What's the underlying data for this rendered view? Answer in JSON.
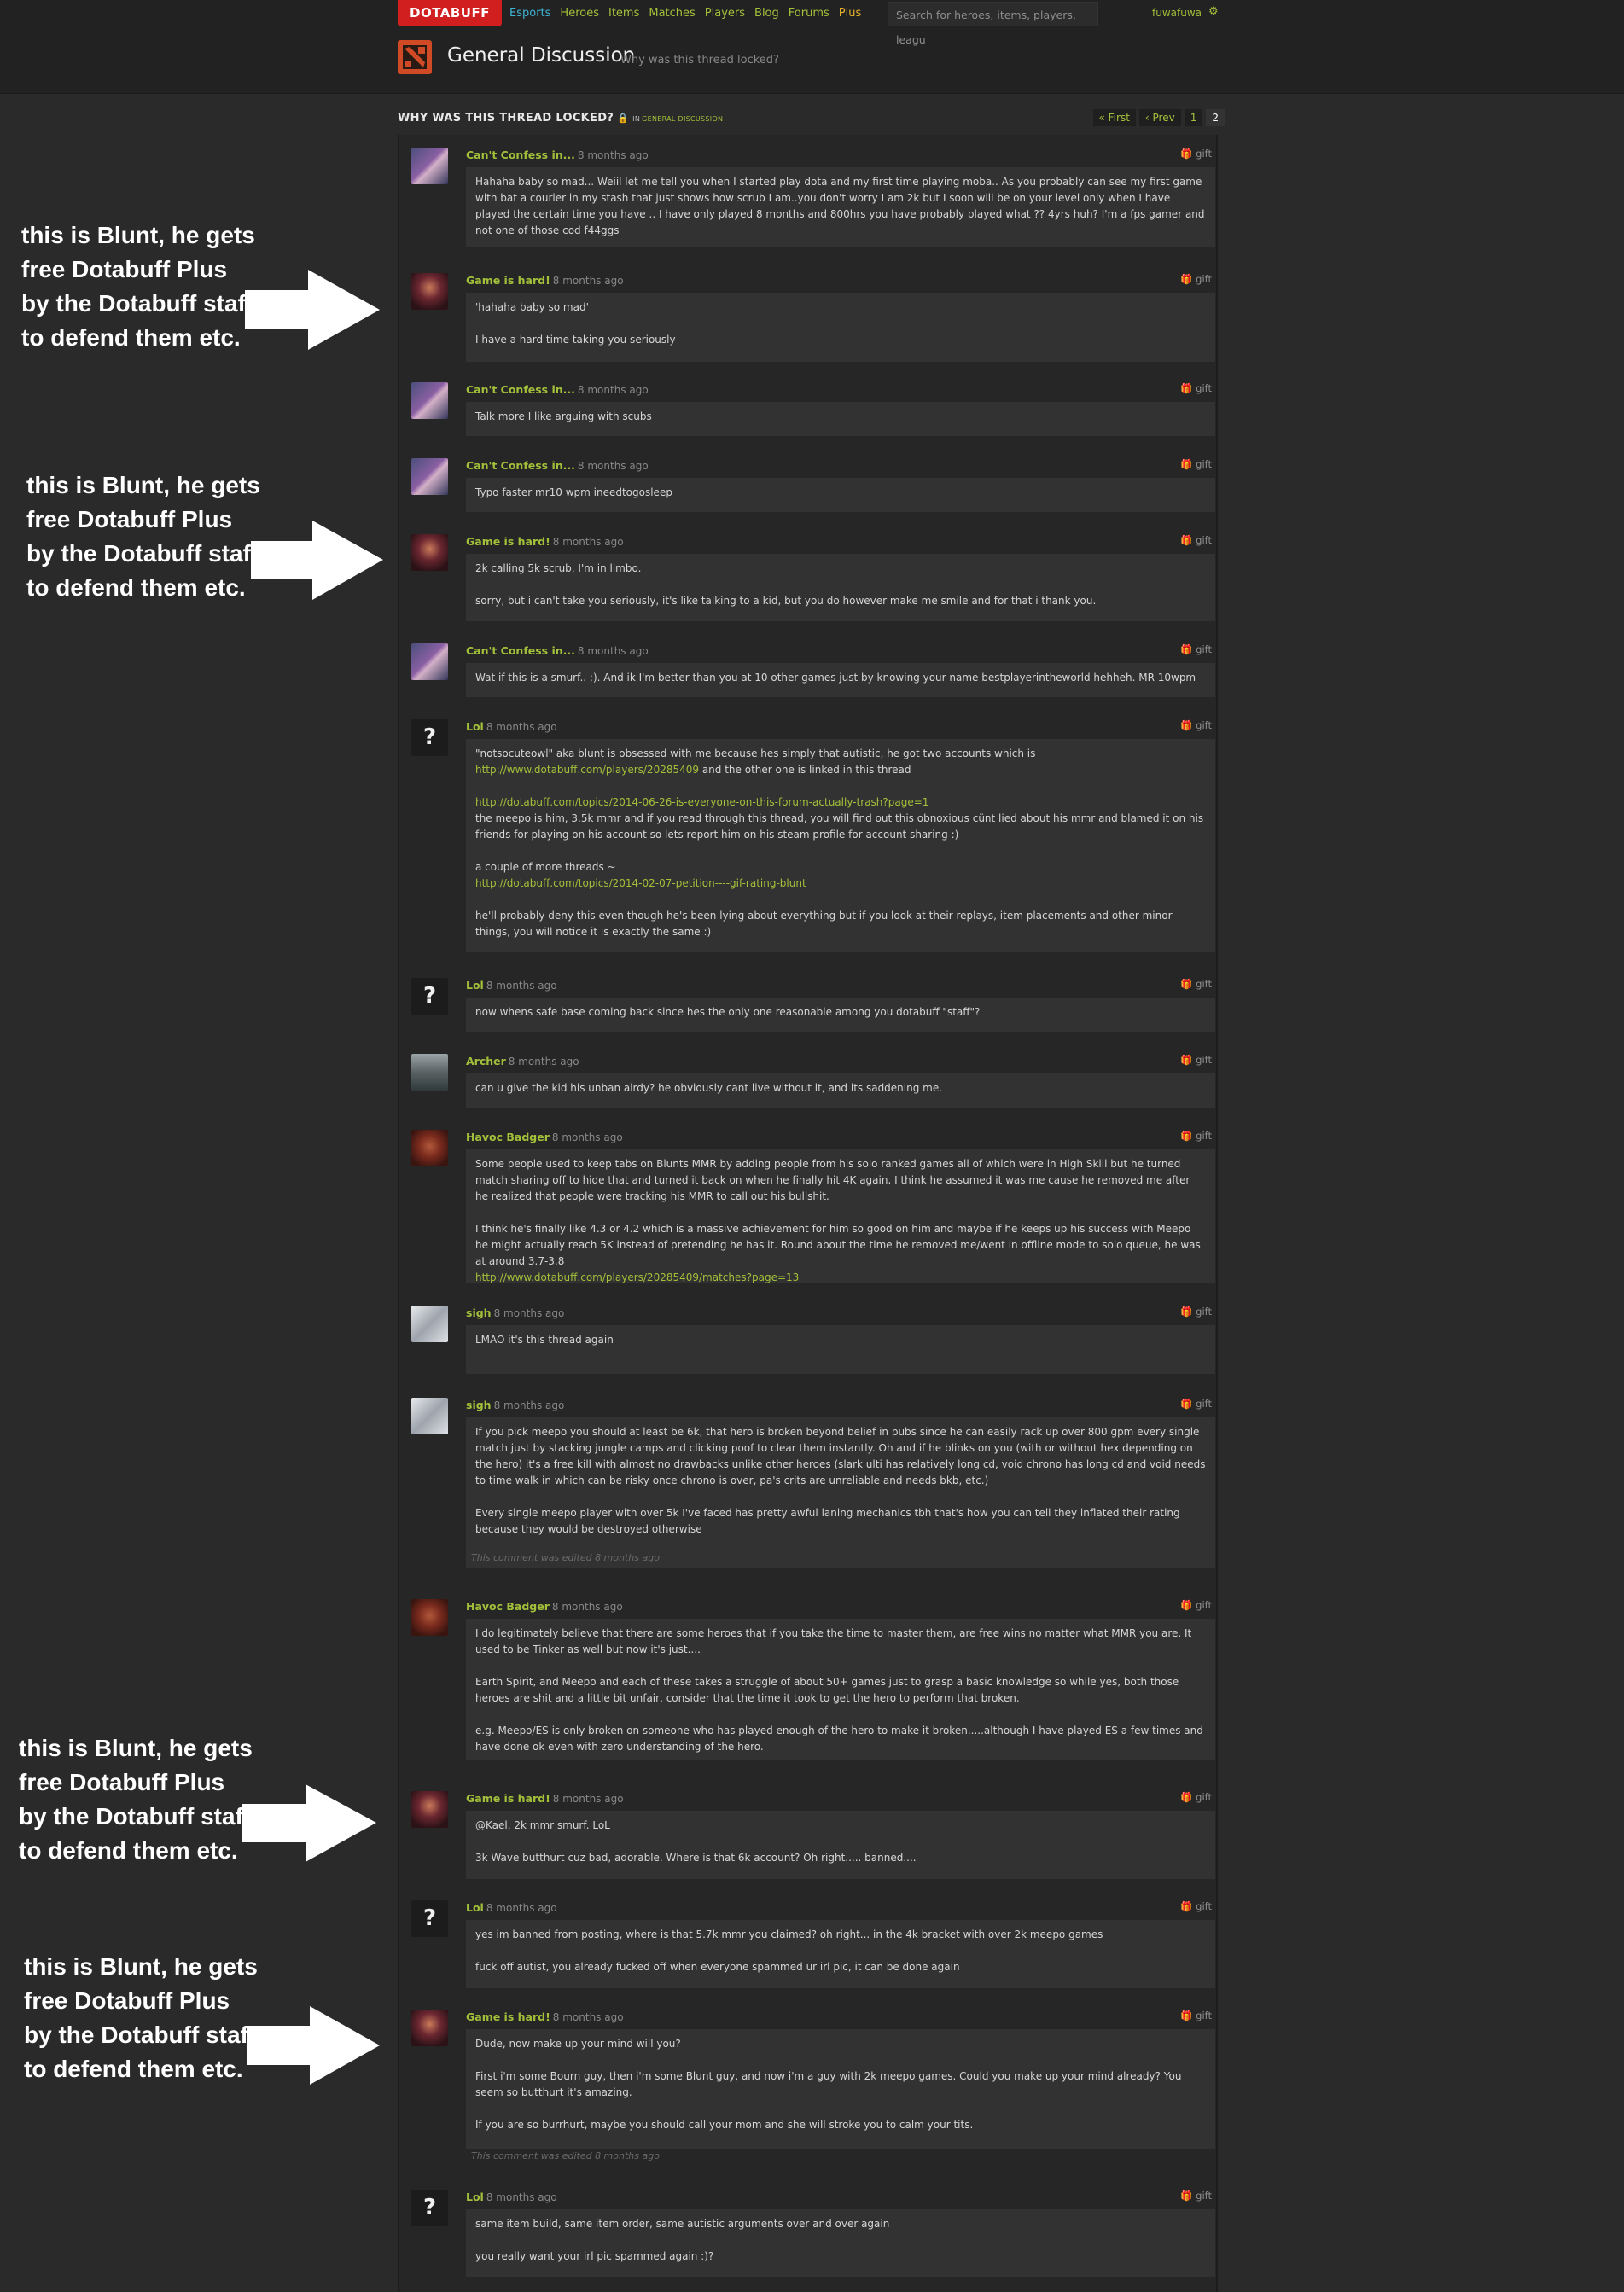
{
  "header": {
    "logo": "DOTABUFF",
    "nav": [
      "Esports",
      "Heroes",
      "Items",
      "Matches",
      "Players",
      "Blog",
      "Forums",
      "Plus"
    ],
    "search_placeholder": "Search for heroes, items, players, leagu",
    "username": "fuwafuwa"
  },
  "section": {
    "title": "General Discussion",
    "subtitle": "Why was this thread locked?"
  },
  "thread": {
    "title": "WHY WAS THIS THREAD LOCKED?",
    "in_label": "IN",
    "category": "GENERAL DISCUSSION",
    "pager": [
      "« First",
      "‹ Prev",
      "1",
      "2"
    ]
  },
  "gift_label": "gift",
  "edited_note": "This comment was edited 8 months ago",
  "annotation_text": "this is Blunt, he gets free Dotabuff Plus by the Dotabuff staff to defend them etc.",
  "posts": [
    {
      "author": "Can't Confess in...",
      "time": "8 months ago",
      "p": [
        "Hahaha baby so mad... Weiil let me tell you when I started play dota and my first time playing moba.. As you probably can see my first game with bat a courier in my stash that just shows how scrub I am..you don't worry I am 2k but I soon will be on your level only when I have played the certain time you have .. I have only played 8 months and 800hrs you have probably played what ?? 4yrs huh? I'm a fps gamer and not one of those cod f44ggs"
      ]
    },
    {
      "author": "Game is hard!",
      "time": "8 months ago",
      "p": [
        "'hahaha baby so mad'",
        "I have a hard time taking you seriously"
      ]
    },
    {
      "author": "Can't Confess in...",
      "time": "8 months ago",
      "p": [
        "Talk more I like arguing with scubs"
      ]
    },
    {
      "author": "Can't Confess in...",
      "time": "8 months ago",
      "p": [
        "Typo faster mr10 wpm ineedtogosleep"
      ]
    },
    {
      "author": "Game is hard!",
      "time": "8 months ago",
      "p": [
        "2k calling 5k scrub, I'm in limbo.",
        "sorry, but i can't take you seriously, it's like talking to a kid, but you do however make me smile and for that i thank you."
      ]
    },
    {
      "author": "Can't Confess in...",
      "time": "8 months ago",
      "p": [
        "Wat if this is a smurf.. ;). And ik I'm better than you at 10 other games just by knowing your name bestplayerintheworld hehheh. MR 10wpm"
      ]
    },
    {
      "author": "Lol",
      "time": "8 months ago",
      "p1a": "\"notsocuteowl\" aka blunt is obsessed with me because hes simply that autistic, he got two accounts which is ",
      "p1link": "http://www.dotabuff.com/players/20285409",
      "p1b": " and the other one is linked in this thread",
      "p2link": "http://dotabuff.com/topics/2014-06-26-is-everyone-on-this-forum-actually-trash?page=1",
      "p2text": "the meepo is him, 3.5k mmr and if you read through this thread, you will find out this obnoxious cünt lied about his mmr and blamed it on his friends for playing on his account so lets report him on his steam profile for account sharing :)",
      "p3text": "a couple of more threads ~",
      "p3link": "http://dotabuff.com/topics/2014-02-07-petition----gif-rating-blunt",
      "p4text": "he'll probably deny this even though he's been lying about everything but if you look at their replays, item placements and other minor things, you will notice it is exactly the same :)"
    },
    {
      "author": "Lol",
      "time": "8 months ago",
      "p": [
        "now whens safe base coming back since hes the only one reasonable among you dotabuff \"staff\"?"
      ]
    },
    {
      "author": "Archer",
      "time": "8 months ago",
      "p": [
        "can u give the kid his unban alrdy? he obviously cant live without it, and its saddening me."
      ]
    },
    {
      "author": "Havoc Badger",
      "time": "8 months ago",
      "p1": "Some people used to keep tabs on Blunts MMR by adding people from his solo ranked games all of which were in High Skill but he turned match sharing off to hide that and turned it back on when he finally hit 4K again. I think he assumed it was me cause he removed me after he realized that people were tracking his MMR to call out his bullshit.",
      "p2": "I think he's finally like 4.3 or 4.2 which is a massive achievement for him so good on him and maybe if he keeps up his success with Meepo he might actually reach 5K instead of pretending he has it. Round about the time he removed me/went in offline mode to solo queue, he was at around 3.7-3.8",
      "p2link": "http://www.dotabuff.com/players/20285409/matches?page=13"
    },
    {
      "author": "sigh",
      "time": "8 months ago",
      "p": [
        "LMAO it's this thread again"
      ]
    },
    {
      "author": "sigh",
      "time": "8 months ago",
      "p": [
        "If you pick meepo you should at least be 6k, that hero is broken beyond belief in pubs since he can easily rack up over 800 gpm every single match just by stacking jungle camps and clicking poof to clear them instantly. Oh and if he blinks on you (with or without hex depending on the hero) it's a free kill with almost no drawbacks unlike other heroes (slark ulti has relatively long cd, void chrono has long cd and void needs to time walk in which can be risky once chrono is over, pa's crits are unreliable and needs bkb, etc.)",
        "Every single meepo player with over 5k I've faced has pretty awful laning mechanics tbh that's how you can tell they inflated their rating because they would be destroyed otherwise"
      ]
    },
    {
      "author": "Havoc Badger",
      "time": "8 months ago",
      "p": [
        "I do legitimately believe that there are some heroes that if you take the time to master them, are free wins no matter what MMR you are. It used to be Tinker as well but now it's just....",
        "Earth Spirit, and Meepo and each of these takes a struggle of about 50+ games just to grasp a basic knowledge so while yes, both those heroes are shit and a little bit unfair, consider that the time it took to get the hero to perform that broken.",
        "e.g. Meepo/ES is only broken on someone who has played enough of the hero to make it broken.....although I have played ES a few times and have done ok even with zero understanding of the hero."
      ]
    },
    {
      "author": "Game is hard!",
      "time": "8 months ago",
      "p": [
        "@Kael, 2k mmr smurf. LoL",
        "3k Wave butthurt cuz bad, adorable. Where is that 6k account? Oh right..... banned...."
      ]
    },
    {
      "author": "Lol",
      "time": "8 months ago",
      "p": [
        "yes im banned from posting, where is that 5.7k mmr you claimed? oh right... in the 4k bracket with over 2k meepo games",
        "fuck off autist, you already fucked off when everyone spammed ur irl pic, it can be done again"
      ]
    },
    {
      "author": "Game is hard!",
      "time": "8 months ago",
      "p": [
        "Dude, now make up your mind will you?",
        "First i'm some Bourn guy, then i'm some Blunt guy, and now i'm a guy with 2k meepo games. Could you make up your mind already? You seem so butthurt it's amazing.",
        "If you are so burrhurt, maybe you should call your mom and she will stroke you to calm your tits."
      ]
    },
    {
      "author": "Lol",
      "time": "8 months ago",
      "p": [
        "same item build, same item order, same autistic arguments over and over again",
        "you really want your irl pic spammed again :)?"
      ]
    }
  ]
}
